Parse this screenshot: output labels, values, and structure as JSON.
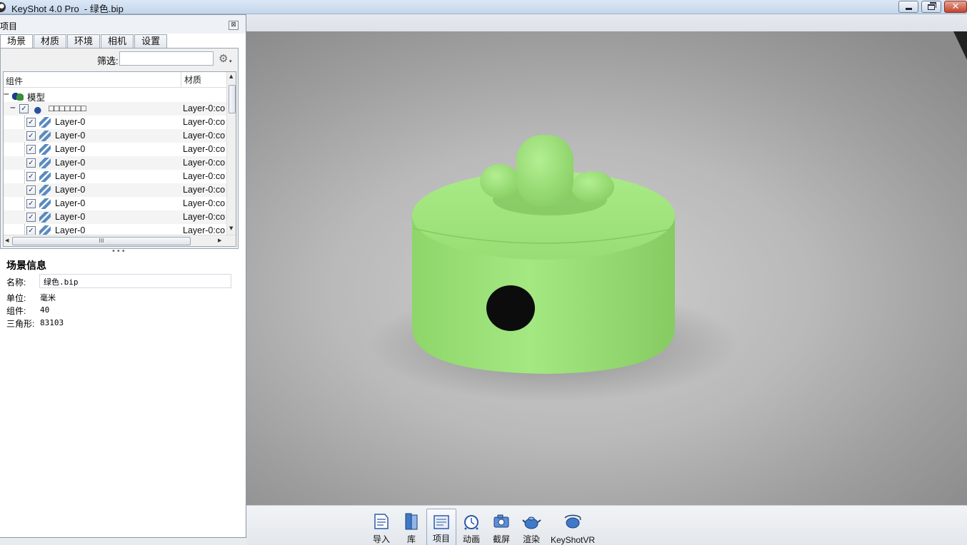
{
  "window": {
    "title": "KeyShot 4.0 Pro  - 绿色.bip",
    "minimize_label": "",
    "maximize_label": "",
    "close_label": "✕"
  },
  "panel": {
    "title": "项目",
    "close_label": "⊠",
    "tabs": [
      "场景",
      "材质",
      "环境",
      "相机",
      "设置"
    ],
    "active_tab": "场景",
    "filter_label": "筛选:",
    "filter_value": "",
    "gear_icon": "⚙",
    "gear_caret": "▾"
  },
  "tree": {
    "columns": [
      "组件",
      "材质"
    ],
    "root": {
      "name": "模型",
      "expander": "−",
      "icon": "model-icon"
    },
    "group": {
      "name": "□□□□□□□",
      "material": "Layer-0:co",
      "expander": "−",
      "checked": "✓",
      "icon": "group-icon"
    },
    "items": [
      {
        "name": "Layer-0",
        "material": "Layer-0:co",
        "checked": "✓"
      },
      {
        "name": "Layer-0",
        "material": "Layer-0:co",
        "checked": "✓"
      },
      {
        "name": "Layer-0",
        "material": "Layer-0:co",
        "checked": "✓"
      },
      {
        "name": "Layer-0",
        "material": "Layer-0:co",
        "checked": "✓"
      },
      {
        "name": "Layer-0",
        "material": "Layer-0:co",
        "checked": "✓"
      },
      {
        "name": "Layer-0",
        "material": "Layer-0:co",
        "checked": "✓"
      },
      {
        "name": "Layer-0",
        "material": "Layer-0:co",
        "checked": "✓"
      },
      {
        "name": "Layer-0",
        "material": "Layer-0:co",
        "checked": "✓"
      },
      {
        "name": "Layer-0",
        "material": "Layer-0:co",
        "checked": "✓"
      }
    ],
    "hscroll_grip": "III",
    "arrow_up": "▲",
    "arrow_down": "▼",
    "arrow_left": "◀",
    "arrow_right": "▶"
  },
  "splitter_grip": "•••",
  "scene_info": {
    "title": "场景信息",
    "name_label": "名称:",
    "name_value": "绿色.bip",
    "unit_label": "单位:",
    "unit_value": "毫米",
    "components_label": "组件:",
    "components_value": "40",
    "triangles_label": "三角形:",
    "triangles_value": "83103"
  },
  "toolbar": {
    "items": [
      {
        "label": "导入",
        "icon": "import-icon"
      },
      {
        "label": "库",
        "icon": "library-icon"
      },
      {
        "label": "项目",
        "icon": "project-icon",
        "active": true
      },
      {
        "label": "动画",
        "icon": "animation-icon"
      },
      {
        "label": "截屏",
        "icon": "screenshot-icon"
      },
      {
        "label": "渲染",
        "icon": "render-icon"
      },
      {
        "label": "KeyShotVR",
        "icon": "keyshotvr-icon"
      }
    ]
  },
  "colors": {
    "model_green": "#9fe07a",
    "model_shadow": "#6fb653",
    "hole": "#0c0c0c",
    "floor": "#b9b9b9"
  }
}
